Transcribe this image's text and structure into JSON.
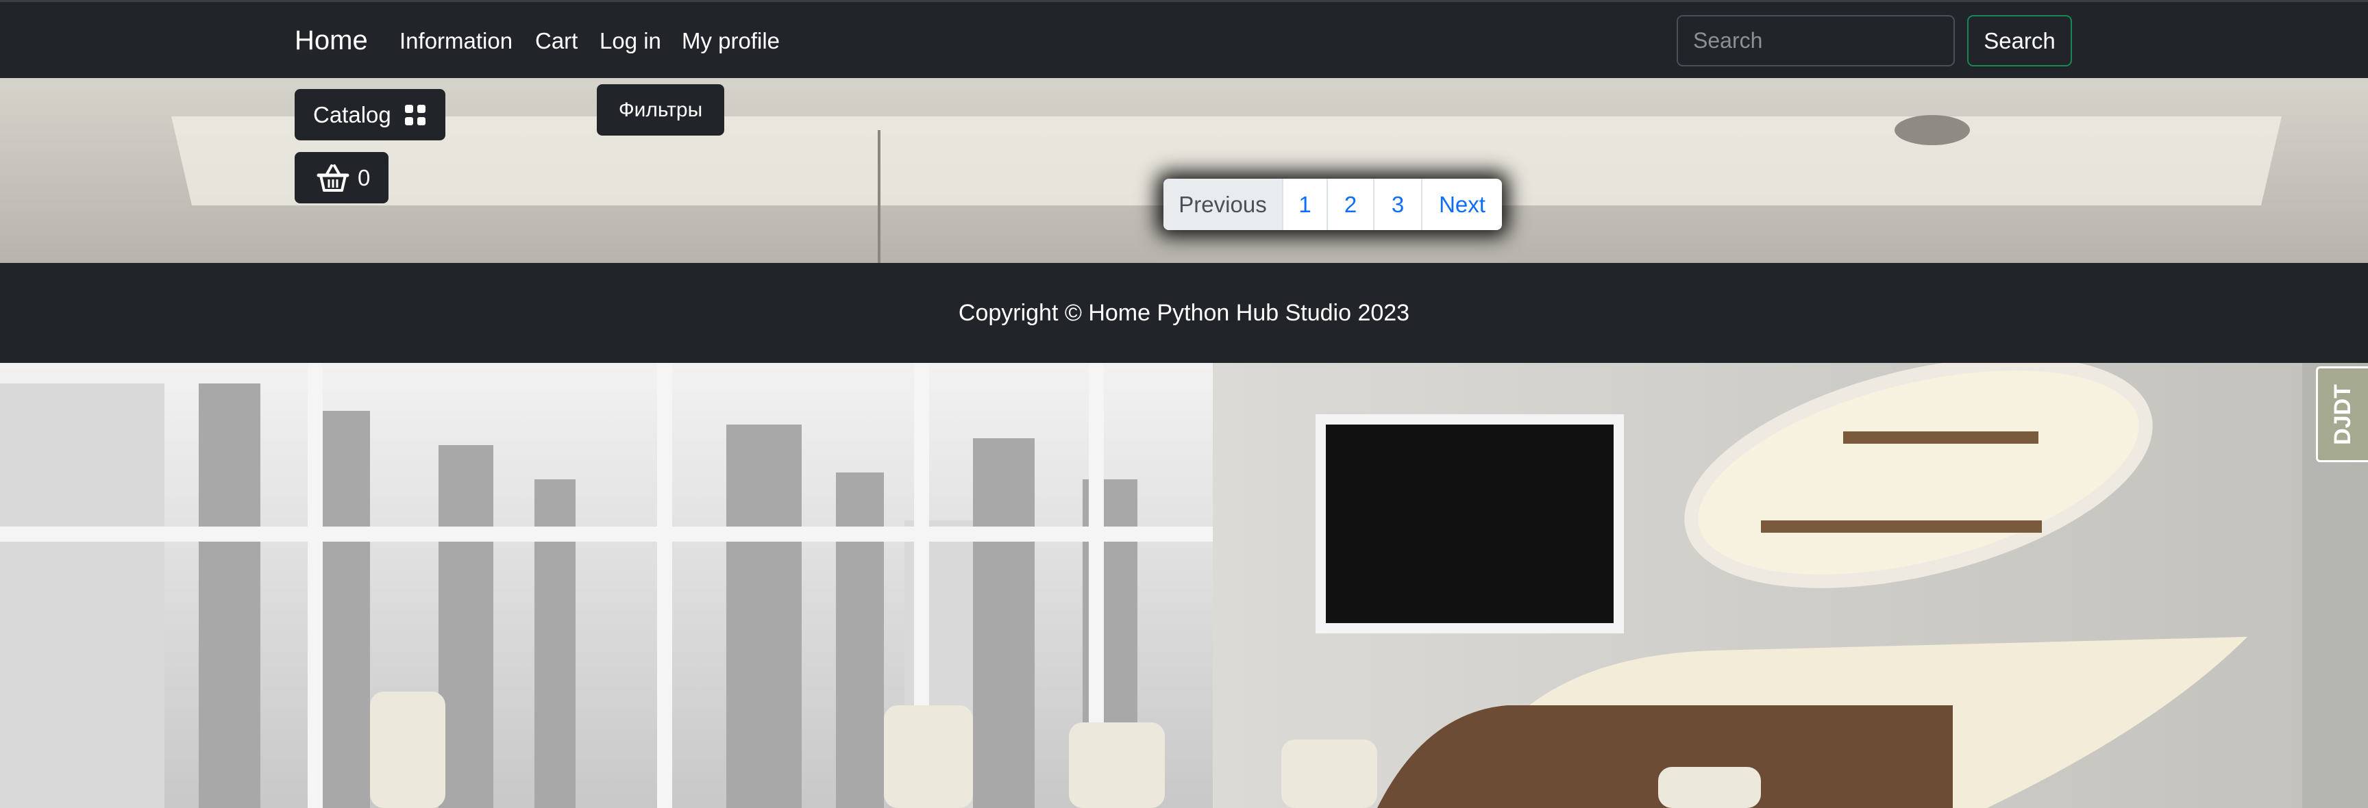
{
  "navbar": {
    "brand": "Home",
    "links": [
      "Information",
      "Cart",
      "Log in",
      "My profile"
    ],
    "search_placeholder": "Search",
    "search_button": "Search"
  },
  "controls": {
    "catalog_label": "Catalog",
    "basket_count": "0",
    "filters_label": "Фильтры"
  },
  "pagination": {
    "previous": "Previous",
    "pages": [
      "1",
      "2",
      "3"
    ],
    "next": "Next"
  },
  "footer": {
    "copyright": "Copyright © Home Python Hub Studio 2023"
  },
  "background": {
    "logo_text": "DJDT"
  },
  "colors": {
    "navbar_bg": "#212529",
    "link_blue": "#0d6efd",
    "search_border_green": "#198754"
  }
}
